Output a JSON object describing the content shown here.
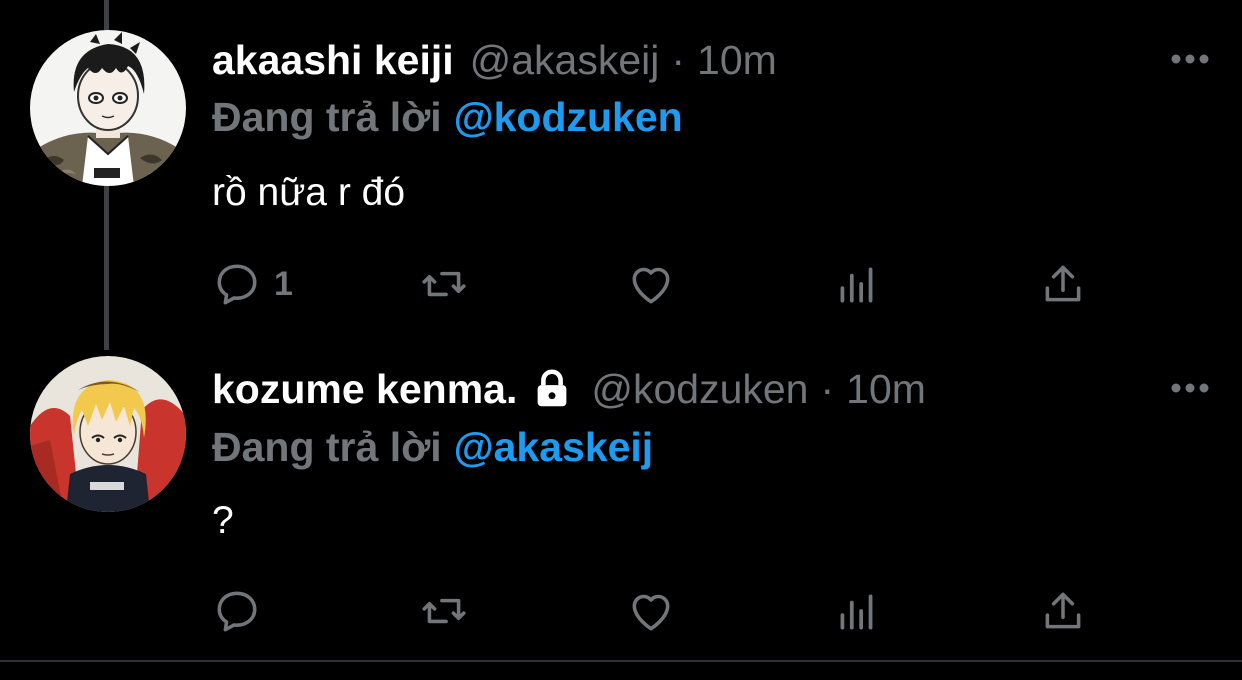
{
  "tweets": [
    {
      "display_name": "akaashi keiji",
      "handle": "@akaskeij",
      "separator": "·",
      "time": "10m",
      "reply_prefix": "Đang trả lời",
      "reply_mention": "@kodzuken",
      "text": "rồ nữa r đó",
      "reply_count": "1",
      "avatar_icon": "akaashi-avatar",
      "locked": false
    },
    {
      "display_name": "kozume kenma.",
      "handle": "@kodzuken",
      "separator": "·",
      "time": "10m",
      "reply_prefix": "Đang trả lời",
      "reply_mention": "@akaskeij",
      "text": "?",
      "reply_count": "",
      "avatar_icon": "kenma-avatar",
      "locked": true
    }
  ],
  "icons": {
    "reply": "reply-icon",
    "retweet": "retweet-icon",
    "like": "heart-icon",
    "stats": "stats-icon",
    "share": "share-icon",
    "more": "more-icon",
    "lock": "lock-icon"
  },
  "colors": {
    "background": "#000000",
    "primary_text": "#ffffff",
    "secondary_text": "#71767b",
    "mention": "#1d9bf0",
    "thread_line": "#3d4144"
  }
}
